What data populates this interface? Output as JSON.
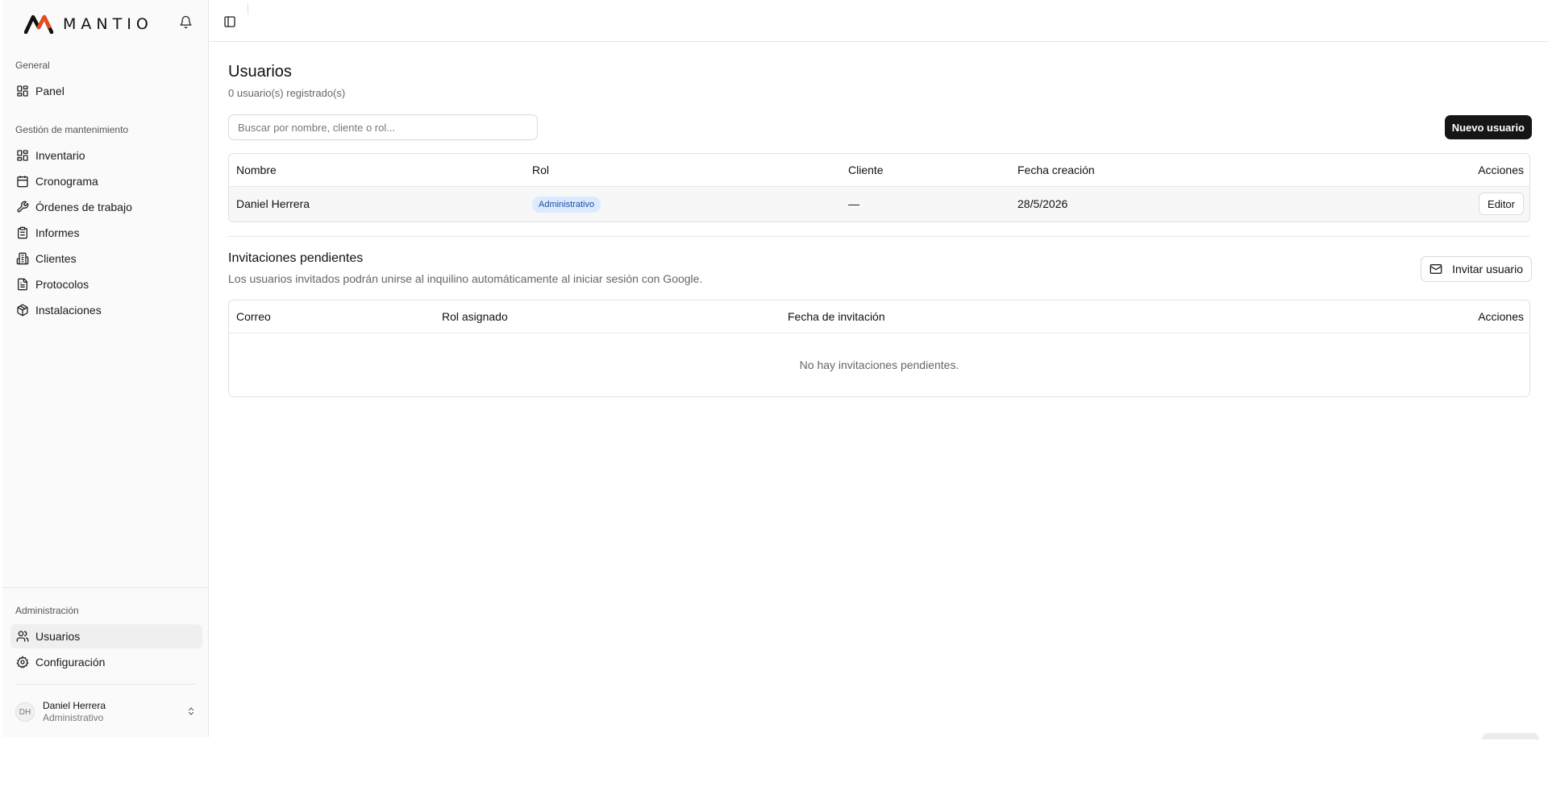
{
  "brand": {
    "name": "MANTIO",
    "logo_icon": "mantio-logo-mark",
    "accent": "#e8491d"
  },
  "sidebar": {
    "groups": [
      {
        "label": "General",
        "items": [
          {
            "label": "Panel",
            "icon": "dashboard-icon"
          }
        ]
      },
      {
        "label": "Gestión de mantenimiento",
        "items": [
          {
            "label": "Inventario",
            "icon": "dashboard-icon"
          },
          {
            "label": "Cronograma",
            "icon": "calendar-icon"
          },
          {
            "label": "Órdenes de trabajo",
            "icon": "wrench-icon"
          },
          {
            "label": "Informes",
            "icon": "clipboard-icon"
          },
          {
            "label": "Clientes",
            "icon": "building-icon"
          },
          {
            "label": "Protocolos",
            "icon": "file-text-icon"
          },
          {
            "label": "Instalaciones",
            "icon": "package-icon"
          }
        ]
      },
      {
        "label": "Administración",
        "items": [
          {
            "label": "Usuarios",
            "icon": "users-icon",
            "active": true
          },
          {
            "label": "Configuración",
            "icon": "settings-icon"
          }
        ]
      }
    ],
    "user": {
      "initials": "DH",
      "name": "Daniel Herrera",
      "role": "Administrativo"
    }
  },
  "page": {
    "title": "Usuarios",
    "subtitle": "0 usuario(s) registrado(s)",
    "search_placeholder": "Buscar por nombre, cliente o rol...",
    "new_user_label": "Nuevo usuario"
  },
  "users_table": {
    "columns": [
      "Nombre",
      "Rol",
      "Cliente",
      "Fecha creación",
      "Acciones"
    ],
    "rows": [
      {
        "nombre": "Daniel Herrera",
        "rol": "Administrativo",
        "cliente": "—",
        "fecha": "28/5/2026",
        "accion": "Editor"
      }
    ]
  },
  "invitations": {
    "title": "Invitaciones pendientes",
    "subtitle": "Los usuarios invitados podrán unirse al inquilino automáticamente al iniciar sesión con Google.",
    "invite_label": "Invitar usuario",
    "columns": [
      "Correo",
      "Rol asignado",
      "Fecha de invitación",
      "Acciones"
    ],
    "empty_text": "No hay invitaciones pendientes."
  },
  "colors": {
    "primary_button": "#161616",
    "badge_bg": "#dbeafe",
    "badge_text": "#1e4e9b"
  }
}
